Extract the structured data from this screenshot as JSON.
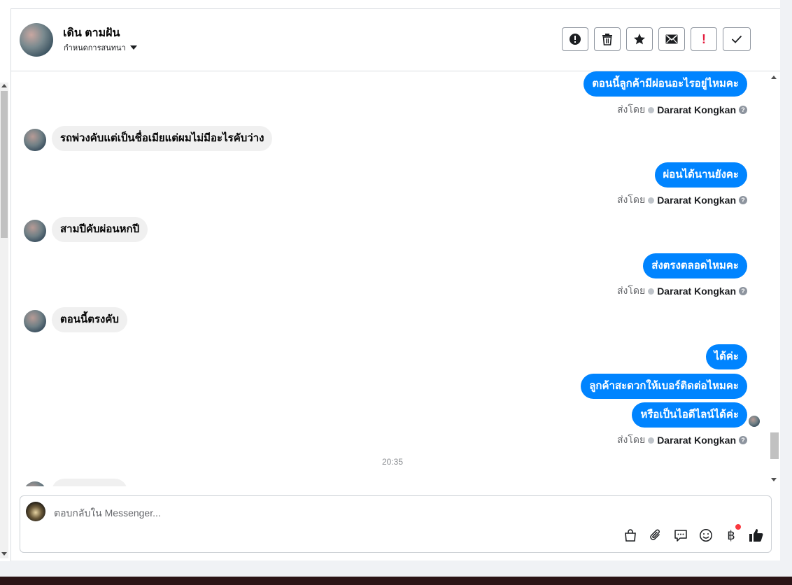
{
  "contact": {
    "name": "เดิน ตามฝัน",
    "assign_label": "กำหนดการสนทนา"
  },
  "toolbar": {
    "buttons": [
      {
        "icon": "alert-circle-icon"
      },
      {
        "icon": "trash-icon"
      },
      {
        "icon": "star-icon"
      },
      {
        "icon": "envelope-icon"
      },
      {
        "icon": "exclamation-icon",
        "text": "!"
      },
      {
        "icon": "check-icon"
      }
    ]
  },
  "messages": {
    "m1": "ตอนนี้ลูกค้ามีผ่อนอะไรอยู่ไหมคะ",
    "m2": "รถพ่วงคับแต่เป็นชื่อเมียแต่ผมไม่มีอะไรคับว่าง",
    "m3": "ผ่อนได้นานยังคะ",
    "m4": "สามปีคับผ่อนหกปี",
    "m5": "ส่งตรงตลอดไหมคะ",
    "m6": "ตอนนี้ตรงคับ",
    "m7": "ได้ค่ะ",
    "m8": "ลูกค้าสะดวกให้เบอร์ติดต่อไหมคะ",
    "m9": "หรือเป็นไอดีไลน์ได้ค่ะ"
  },
  "sent_by": {
    "prefix": "ส่งโดย",
    "agent": "Dararat Kongkan",
    "help": "?"
  },
  "timestamp": "20:35",
  "composer": {
    "placeholder": "ตอบกลับใน Messenger...",
    "tools": [
      "shopping-bag-icon",
      "paperclip-icon",
      "saved-reply-icon",
      "emoji-icon",
      "baht-payment-icon",
      "thumbs-up-icon"
    ],
    "baht_symbol": "฿"
  },
  "colors": {
    "outgoing_bubble": "#0084ff",
    "incoming_bubble": "#f0f0f0",
    "alert_red": "#e41e3f",
    "notification_dot": "#fa383e"
  }
}
